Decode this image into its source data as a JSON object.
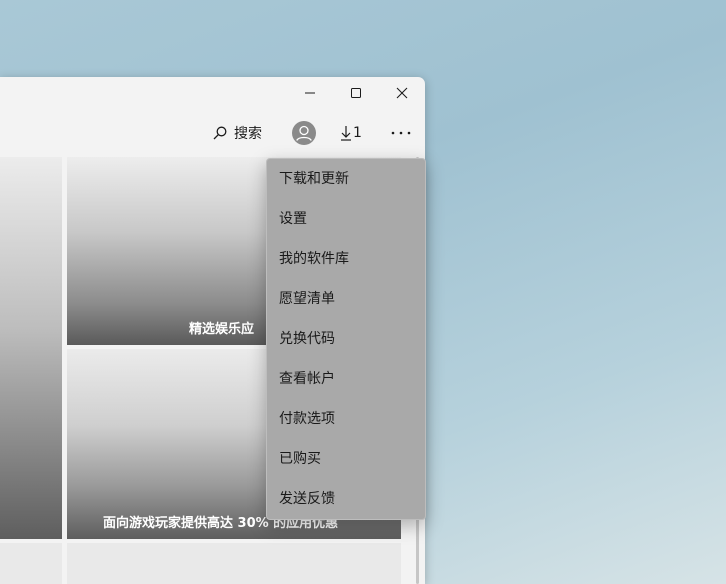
{
  "window": {
    "controls": {
      "minimize": "minimize-icon",
      "maximize": "maximize-icon",
      "close": "close-icon"
    }
  },
  "toolbar": {
    "search_label": "搜索",
    "download_count": "1"
  },
  "tiles": {
    "top_caption": "精选娱乐应",
    "bottom_caption": "面向游戏玩家提供高达 30% 的应用优惠"
  },
  "menu": {
    "items": [
      {
        "label": "下载和更新"
      },
      {
        "label": "设置"
      },
      {
        "label": "我的软件库"
      },
      {
        "label": "愿望清单"
      },
      {
        "label": "兑换代码"
      },
      {
        "label": "查看帐户"
      },
      {
        "label": "付款选项"
      },
      {
        "label": "已购买"
      },
      {
        "label": "发送反馈"
      }
    ]
  },
  "colors": {
    "menu_bg": "#a9a9a9",
    "window_bg": "#f3f3f3"
  }
}
